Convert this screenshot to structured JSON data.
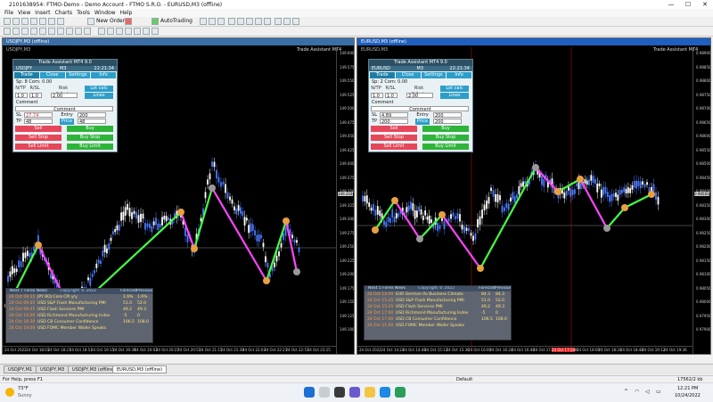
{
  "titlebar": {
    "text": "2101638954: FTMO-Demo - Demo Account - FTMO S.R.O. - EURUSD,M3 (offline)",
    "minimize": "—",
    "maximize": "☐",
    "close": "✕"
  },
  "menu": [
    "File",
    "View",
    "Insert",
    "Charts",
    "Tools",
    "Window",
    "Help"
  ],
  "toolbar": {
    "new_order": "New Order",
    "autotrading": "AutoTrading"
  },
  "windows": {
    "left": {
      "caption": "USDJPY,M3 (offline)",
      "symbol_line": "USDJPY,M3",
      "indicator_name": "Trade Assistant MT4",
      "price_labels": [
        "149.600",
        "149.575",
        "149.550",
        "149.525",
        "149.500",
        "149.475",
        "149.450",
        "149.425",
        "149.400",
        "149.375",
        "149.350",
        "149.325",
        "149.300",
        "149.275",
        "149.250",
        "149.225",
        "149.200",
        "149.175",
        "149.150",
        "149.125",
        "149.100"
      ],
      "current_price": "149.318",
      "time_labels": [
        "24 Oct 2022",
        "24 Oct 18:03",
        "24 Oct 18:27",
        "24 Oct 18:51",
        "24 Oct 19:15",
        "24 Oct 19:39",
        "24 Oct 20:03",
        "24 Oct 20:27",
        "24 Oct 20:51",
        "24 Oct 21:15",
        "24 Oct 21:39",
        "24 Oct 22:03",
        "24 Oct 22:27",
        "24 Oct 22:51",
        "24 Oct 23:15"
      ]
    },
    "right": {
      "caption": "EURUSD,M3 (offline)",
      "symbol_line": "EURUSD,M3",
      "indicator_name": "Trade Assistant MT4",
      "price_labels": [
        "0.98900",
        "0.98850",
        "0.98800",
        "0.98750",
        "0.98700",
        "0.98650",
        "0.98600",
        "0.98550",
        "0.98500",
        "0.98450",
        "0.98400",
        "0.98350",
        "0.98300",
        "0.98250",
        "0.98200",
        "0.98150",
        "0.98100",
        "0.98050",
        "0.98000",
        "0.97950",
        "0.97900"
      ],
      "current_price": "0.98583",
      "time_labels": [
        "24 Oct 2022",
        "24 Oct 14:24",
        "24 Oct 14:48",
        "24 Oct 15:12",
        "24 Oct 15:36",
        "24 Oct 16:00",
        "24 Oct 16:24",
        "24 Oct 16:48",
        "24 Oct 17:12",
        "24 Oct 17:36",
        "24 Oct 18:00",
        "24 Oct 18:24",
        "24 Oct 18:48",
        "24 Oct 19:12",
        "24 Oct 19:36"
      ],
      "time_highlight": "24 Oct 17:24"
    }
  },
  "trade_panels": {
    "left": {
      "title": "Trade Assistant MT4 9.0",
      "symbol": "USDJPY",
      "tf": "M3",
      "clock": "22:21:34",
      "tabs": [
        "Trade",
        "Close",
        "Settings",
        "Info"
      ],
      "spread": "Sp: 8  Com: 0.00",
      "lots_label": "N/TP",
      "rr_label": "R/SL",
      "risk_label": "Risk %/Lots",
      "lots": "1.0",
      "rr": "1.0",
      "risk": "2.00",
      "lot_calc": "Lot calc",
      "lines": "Lines",
      "comment_label": "Comment",
      "comment": "Comment",
      "sl_label": "SL",
      "sl": "27.74",
      "entry_label": "Entry",
      "entry": "200",
      "tp_label": "TP",
      "tp": "48",
      "price_label": "Price",
      "price": "48",
      "sell": "Sell",
      "buy": "Buy",
      "sell_stop": "Sell Stop",
      "buy_stop": "Buy Stop",
      "sell_limit": "Sell Limit",
      "buy_limit": "Buy Limit"
    },
    "right": {
      "title": "Trade Assistant MT4 9.0",
      "symbol": "EURUSD",
      "tf": "M3",
      "clock": "22:21:34",
      "tabs": [
        "Trade",
        "Close",
        "Settings",
        "Info"
      ],
      "spread": "Sp: 2  Com: 0.00",
      "lots_label": "N/TP",
      "rr_label": "R/SL",
      "risk_label": "Risk %/Lots",
      "lots": "1.0",
      "rr": "1.0",
      "risk": "2.00",
      "lot_calc": "Lot calc",
      "lines": "Lines",
      "comment_label": "Comment",
      "comment": "Comment",
      "sl_label": "SL",
      "sl": "4.89",
      "entry_label": "Entry",
      "entry": "200",
      "tp_label": "TP",
      "tp": "200",
      "price_label": "Price",
      "price": "200",
      "sell": "Sell",
      "buy": "Buy",
      "sell_stop": "Sell Stop",
      "buy_stop": "Buy Stop",
      "sell_limit": "Sell Limit",
      "buy_limit": "Buy Limit"
    }
  },
  "news": {
    "left": {
      "title": "Next 7 Forex News",
      "columns": [
        "Copyright © 2022",
        "Forecast",
        "Previous"
      ],
      "rows": [
        {
          "time": "24 Oct 09:15",
          "text": "JPY  BOJ Core CPI y/y",
          "f": "1.6%",
          "p": "1.6%"
        },
        {
          "time": "24 Oct 09:45",
          "text": "USD  S&P Flash Manufacturing PMI",
          "f": "51.0",
          "p": "52.0"
        },
        {
          "time": "24 Oct 09:45",
          "text": "USD  Flash Services PMI",
          "f": "49.2",
          "p": "49.3"
        },
        {
          "time": "24 Oct 16:00",
          "text": "USD  Richmond Manufacturing Index",
          "f": "-5",
          "p": "0"
        },
        {
          "time": "24 Oct 16:30",
          "text": "USD  CB Consumer Confidence",
          "f": "106.5",
          "p": "108.0"
        },
        {
          "time": "24 Oct 18:00",
          "text": "USD  FOMC Member Waller Speaks",
          "f": "",
          "p": ""
        }
      ]
    },
    "right": {
      "title": "Next 5 Forex News",
      "columns": [
        "Copyright © 2022",
        "Forecast",
        "Previous"
      ],
      "rows": [
        {
          "time": "24 Oct 14:00",
          "text": "EUR  German ifo Business Climate",
          "f": "84.3",
          "p": "84.3"
        },
        {
          "time": "24 Oct 15:45",
          "text": "USD  S&P Flash Manufacturing PMI",
          "f": "51.0",
          "p": "52.0"
        },
        {
          "time": "24 Oct 15:45",
          "text": "USD  Flash Services PMI",
          "f": "49.2",
          "p": "49.3"
        },
        {
          "time": "24 Oct 17:00",
          "text": "USD  Richmond Manufacturing Index",
          "f": "-5",
          "p": "0"
        },
        {
          "time": "24 Oct 17:00",
          "text": "USD  CB Consumer Confidence",
          "f": "106.5",
          "p": "108.0"
        },
        {
          "time": "24 Oct 21:00",
          "text": "USD  FOMC Member Waller Speaks",
          "f": "",
          "p": ""
        }
      ]
    }
  },
  "chart_tabs": [
    "USDJPY,M1",
    "USDJPY,M3",
    "USDJPY,M3 (offline)",
    "EURUSD,M3 (offline)"
  ],
  "status": {
    "help": "For Help, press F1",
    "profile": "Default",
    "traffic": "17562/2 kb"
  },
  "taskbar": {
    "temp": "73°F",
    "weather": "Sunny",
    "time": "12:21 PM",
    "date": "10/24/2022"
  },
  "colors": {
    "bull": "#ffffff",
    "bear": "#4a78ff",
    "zigzag_up": "#44ff44",
    "zigzag_down": "#ff44ff",
    "pivot": "#e8a040",
    "sell": "#e5475a",
    "buy": "#2fb43a"
  }
}
